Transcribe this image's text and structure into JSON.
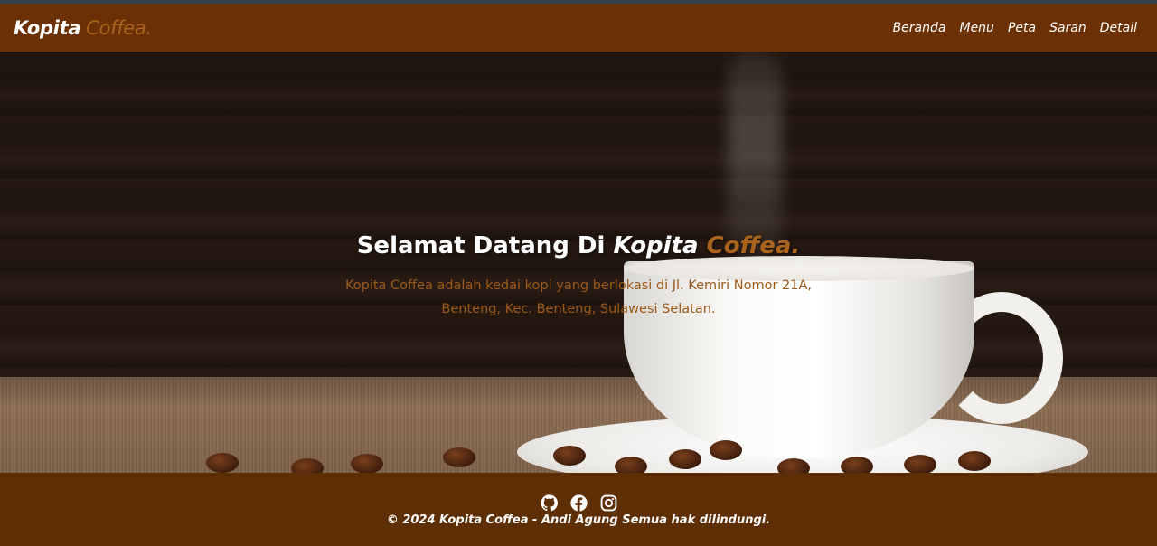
{
  "brand": {
    "name": "Kopita",
    "accent": "Coffea."
  },
  "nav": [
    {
      "label": "Beranda"
    },
    {
      "label": "Menu"
    },
    {
      "label": "Peta"
    },
    {
      "label": "Saran"
    },
    {
      "label": "Detail"
    }
  ],
  "hero": {
    "title_prefix": "Selamat Datang Di ",
    "title_brand": "Kopita",
    "title_accent": "Coffea.",
    "description": "Kopita Coffea adalah kedai kopi yang berlokasi di Jl. Kemiri Nomor 21A, Benteng, Kec. Benteng, Sulawesi Selatan."
  },
  "footer": {
    "socials": [
      "github-icon",
      "facebook-icon",
      "instagram-icon"
    ],
    "copyright": "© 2024 Kopita Coffea - Andi Agung Semua hak dilindungi."
  },
  "colors": {
    "navbar": "#6b3104",
    "accent": "#a9631c",
    "footer": "#5e2e05"
  }
}
